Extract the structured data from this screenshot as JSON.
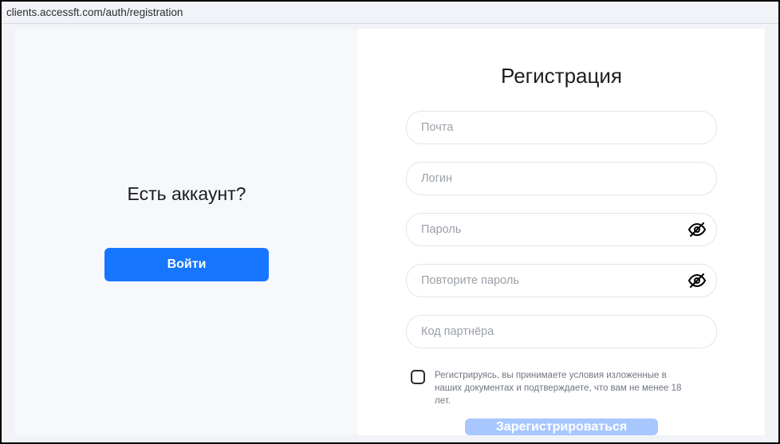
{
  "browser": {
    "url": "clients.accessft.com/auth/registration"
  },
  "left": {
    "title": "Есть аккаунт?",
    "login_button": "Войти"
  },
  "right": {
    "title": "Регистрация",
    "email_placeholder": "Почта",
    "login_placeholder": "Логин",
    "password_placeholder": "Пароль",
    "password2_placeholder": "Повторите пароль",
    "partner_placeholder": "Код партнёра",
    "consent_text": "Регистрируясь, вы принимаете условия изложенные в наших документах и подтверждаете, что вам не менее 18 лет.",
    "submit_button": "Зарегистрироваться"
  }
}
